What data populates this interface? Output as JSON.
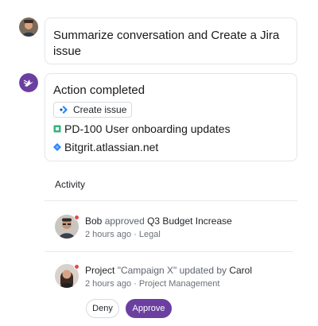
{
  "user_message": {
    "text": "Summarize conversation and Create a Jira issue"
  },
  "bot_message": {
    "title": "Action completed",
    "action_chip": "Create issue",
    "issue": "PD-100 User onboarding updates",
    "site": "Bitgrit.atlassian.net"
  },
  "activity": {
    "title": "Activity",
    "items": [
      {
        "actor": "Bob",
        "verb": "approved",
        "object": "Q3 Budget Increase",
        "time": "2 hours ago",
        "separator": "·",
        "context": "Legal"
      },
      {
        "subject": "Project",
        "quoted": "\"Campaign X\"",
        "verb": "updated by",
        "actor": "Carol",
        "time": "2 hours ago",
        "separator": "·",
        "context": "Project Management",
        "deny_label": "Deny",
        "approve_label": "Approve"
      }
    ]
  },
  "colors": {
    "accent": "#6b3fa0",
    "notification_dot": "#e5484d",
    "jira_blue": "#2684ff",
    "issue_green": "#36b37e"
  }
}
